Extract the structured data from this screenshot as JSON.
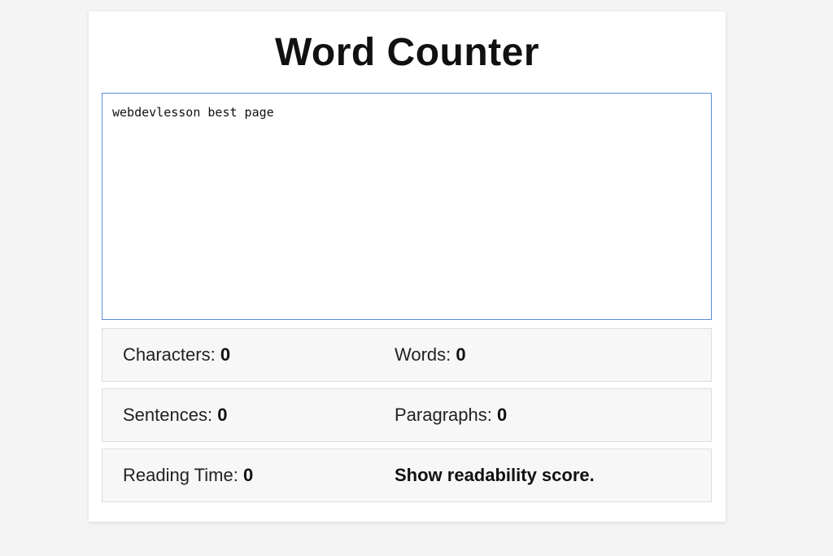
{
  "app": {
    "title": "Word Counter"
  },
  "editor": {
    "text": "webdevlesson best page"
  },
  "stats": {
    "characters_label": "Characters: ",
    "characters_value": "0",
    "words_label": "Words: ",
    "words_value": "0",
    "sentences_label": "Sentences: ",
    "sentences_value": "0",
    "paragraphs_label": "Paragraphs: ",
    "paragraphs_value": "0",
    "reading_time_label": "Reading Time: ",
    "reading_time_value": "0",
    "readability_link": "Show readability score."
  },
  "colors": {
    "focus_border": "#5b8fd9",
    "panel_bg": "#f7f7f7",
    "page_bg": "#f4f4f4"
  }
}
